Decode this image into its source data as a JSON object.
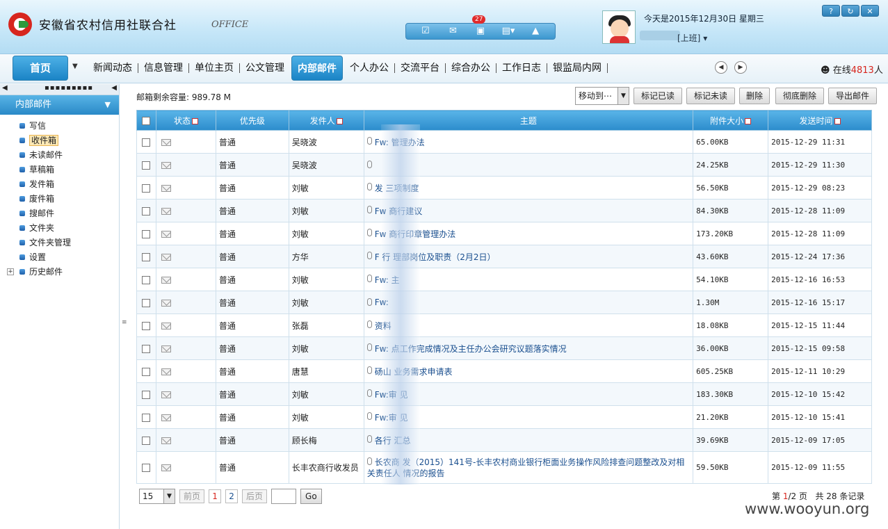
{
  "header": {
    "logo_text": "安徽省农村信用社联合社",
    "logo_sub": "OFFICE",
    "badge_count": "27",
    "date_text": "今天是2015年12月30日  星期三",
    "user_status": "[上班]",
    "toolbar_icons": [
      "checkbox-icon",
      "mail-icon",
      "briefcase-icon",
      "document-icon",
      "shirt-icon"
    ],
    "win_buttons": [
      "help-icon",
      "refresh-icon",
      "close-icon"
    ]
  },
  "nav": {
    "home": "首页",
    "items": [
      "新闻动态",
      "信息管理",
      "单位主页",
      "公文管理",
      "内部邮件",
      "个人办公",
      "交流平台",
      "综合办公",
      "工作日志",
      "银监局内网"
    ],
    "active_index": 4,
    "online_label": "在线",
    "online_count": "4813",
    "online_unit": "人"
  },
  "sidebar": {
    "title": "内部邮件",
    "items": [
      "写信",
      "收件箱",
      "未读邮件",
      "草稿箱",
      "发件箱",
      "废件箱",
      "搜邮件",
      "文件夹",
      "文件夹管理",
      "设置",
      "历史邮件"
    ],
    "selected_index": 1
  },
  "main": {
    "quota": "邮箱剩余容量: 989.78 M",
    "move_to": "移动到⋯",
    "actions": [
      "标记已读",
      "标记未读",
      "删除",
      "彻底删除",
      "导出邮件"
    ],
    "columns": [
      "状态",
      "优先级",
      "发件人",
      "主题",
      "附件大小",
      "发送时间"
    ],
    "rows": [
      {
        "priority": "普通",
        "sender": "吴晓波",
        "subject": "Fw:  管理办法",
        "size": "65.00KB",
        "time": "2015-12-29 11:31"
      },
      {
        "priority": "普通",
        "sender": "吴晓波",
        "subject": "",
        "size": "24.25KB",
        "time": "2015-12-29 11:30"
      },
      {
        "priority": "普通",
        "sender": "刘敏",
        "subject": "发  三项制度",
        "size": "56.50KB",
        "time": "2015-12-29 08:23"
      },
      {
        "priority": "普通",
        "sender": "刘敏",
        "subject": "Fw  商行建议",
        "size": "84.30KB",
        "time": "2015-12-28 11:09"
      },
      {
        "priority": "普通",
        "sender": "刘敏",
        "subject": "Fw  商行印章管理办法",
        "size": "173.20KB",
        "time": "2015-12-28 11:09"
      },
      {
        "priority": "普通",
        "sender": "方华",
        "subject": "F  行  理部岗位及职责（2月2日）",
        "size": "43.60KB",
        "time": "2015-12-24 17:36"
      },
      {
        "priority": "普通",
        "sender": "刘敏",
        "subject": "Fw:  主",
        "size": "54.10KB",
        "time": "2015-12-16 16:53"
      },
      {
        "priority": "普通",
        "sender": "刘敏",
        "subject": "Fw:  ",
        "size": "1.30M",
        "time": "2015-12-16 15:17"
      },
      {
        "priority": "普通",
        "sender": "张磊",
        "subject": "资料",
        "size": "18.08KB",
        "time": "2015-12-15 11:44"
      },
      {
        "priority": "普通",
        "sender": "刘敏",
        "subject": "Fw:  点工作完成情况及主任办公会研究议题落实情况",
        "size": "36.00KB",
        "time": "2015-12-15 09:58"
      },
      {
        "priority": "普通",
        "sender": "唐慧",
        "subject": "砀山  业务需求申请表",
        "size": "605.25KB",
        "time": "2015-12-11 10:29"
      },
      {
        "priority": "普通",
        "sender": "刘敏",
        "subject": "Fw:审  见",
        "size": "183.30KB",
        "time": "2015-12-10 15:42"
      },
      {
        "priority": "普通",
        "sender": "刘敏",
        "subject": "Fw:审  见",
        "size": "21.20KB",
        "time": "2015-12-10 15:41"
      },
      {
        "priority": "普通",
        "sender": "顾长梅",
        "subject": "各行  汇总",
        "size": "39.69KB",
        "time": "2015-12-09 17:05"
      },
      {
        "priority": "普通",
        "sender": "长丰农商行收发员",
        "subject": "长农商  发（2015）141号-长丰农村商业银行柜面业务操作风险排查问题整改及对相关责任人  情况的报告",
        "size": "59.50KB",
        "time": "2015-12-09 11:55"
      }
    ]
  },
  "pager": {
    "page_size": "15",
    "prev": "前页",
    "pages": [
      "1",
      "2"
    ],
    "next": "后页",
    "go": "Go",
    "info_prefix": "第",
    "current": "1",
    "total_pages": "/2 页",
    "records": "共  28  条记录"
  },
  "watermark": "www.wooyun.org",
  "colors": {
    "accent": "#2c8ccc",
    "badge": "#e02b2b",
    "link": "#1a4f8f"
  }
}
